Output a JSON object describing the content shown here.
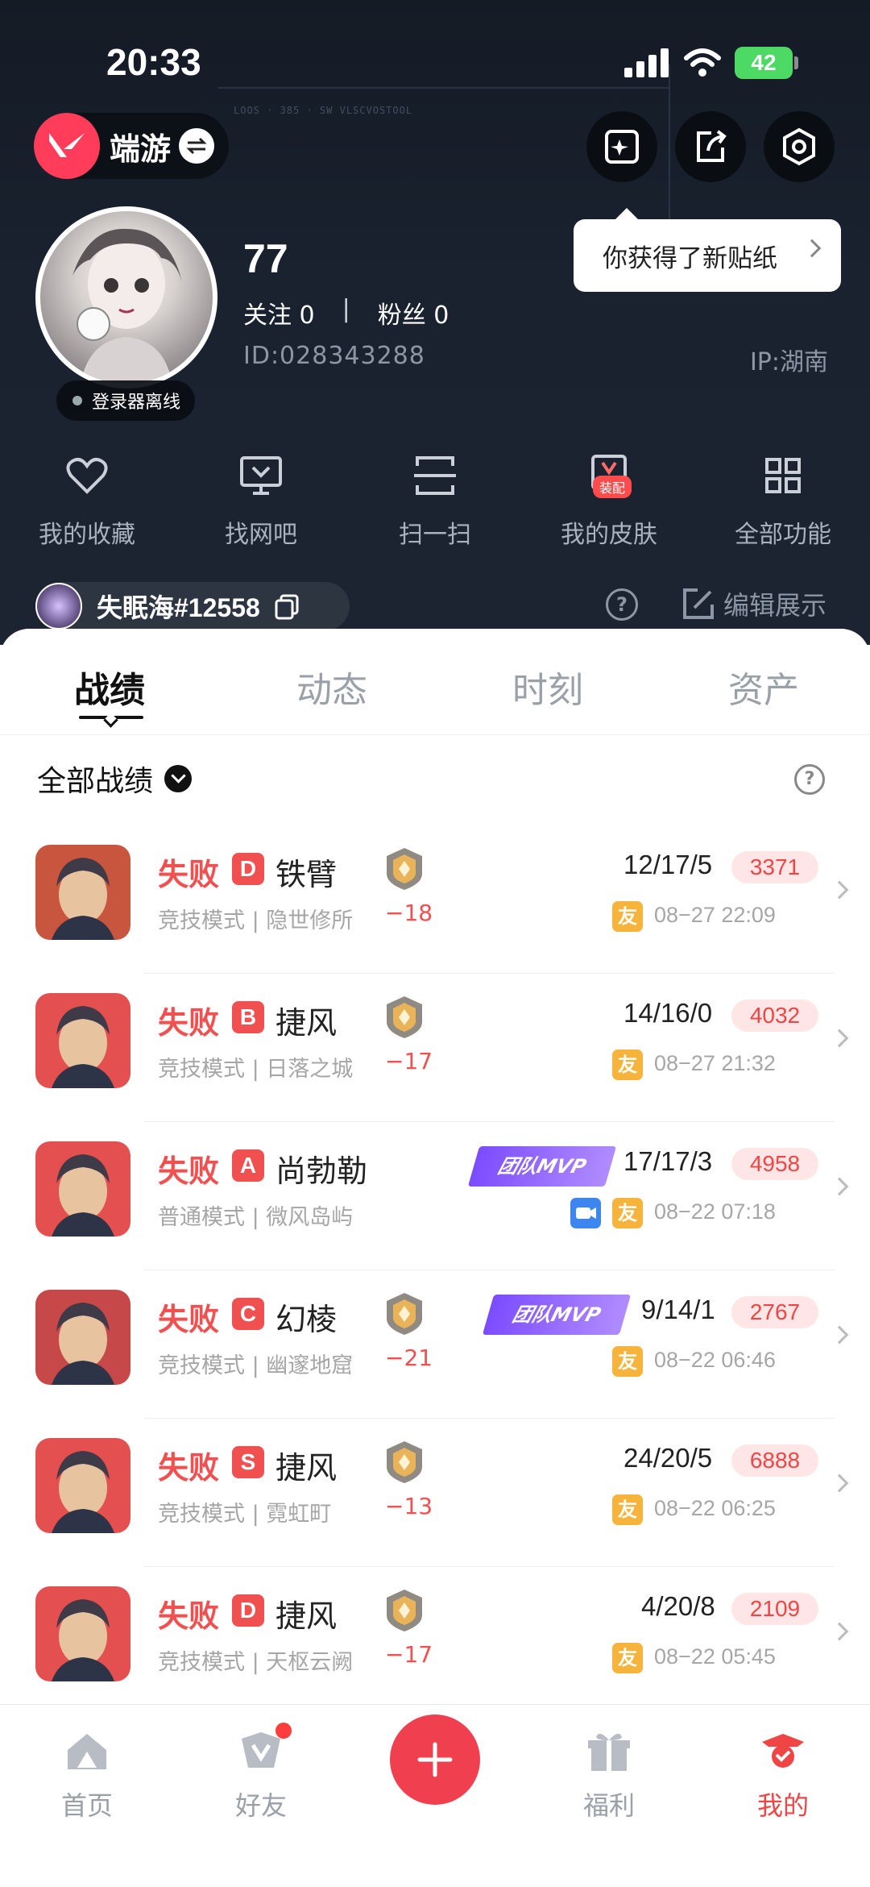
{
  "status_bar": {
    "time": "20:33",
    "battery": "42"
  },
  "header": {
    "app_switch_label": "端游",
    "tooltip": "你获得了新贴纸",
    "online_status": "登录器离线",
    "username": "77",
    "following_label": "关注 0",
    "followers_label": "粉丝 0",
    "follow_separator": "|",
    "user_id": "ID:028343288",
    "ip": "IP:湖南",
    "game_id": "失眠海#12558",
    "edit_show": "编辑展示",
    "help_glyph": "?",
    "hud_text": "LOOS · 385 · SW VLSCVOSTOOL"
  },
  "quick_actions": [
    {
      "label": "我的收藏",
      "icon": "heart-icon"
    },
    {
      "label": "找网吧",
      "icon": "monitor-icon"
    },
    {
      "label": "扫一扫",
      "icon": "scan-icon"
    },
    {
      "label": "我的皮肤",
      "icon": "skin-icon",
      "badge": "装配"
    },
    {
      "label": "全部功能",
      "icon": "grid-icon"
    }
  ],
  "tabs": [
    {
      "label": "战绩",
      "active": true
    },
    {
      "label": "动态",
      "active": false
    },
    {
      "label": "时刻",
      "active": false
    },
    {
      "label": "资产",
      "active": false
    }
  ],
  "filter": {
    "label": "全部战绩",
    "help_glyph": "?"
  },
  "matches": [
    {
      "result": "失败",
      "rank": "D",
      "agent": "铁臂",
      "mode": "竞技模式 | 隐世修所",
      "delta": "−18",
      "mvp": "",
      "kda": "12/17/5",
      "score": "3371",
      "friend": "友",
      "video": false,
      "date": "08−27 22:09",
      "agent_color": "#c8553d"
    },
    {
      "result": "失败",
      "rank": "B",
      "agent": "捷风",
      "mode": "竞技模式 | 日落之城",
      "delta": "−17",
      "mvp": "",
      "kda": "14/16/0",
      "score": "4032",
      "friend": "友",
      "video": false,
      "date": "08−27 21:32",
      "agent_color": "#e4504f"
    },
    {
      "result": "失败",
      "rank": "A",
      "agent": "尚勃勒",
      "mode": "普通模式 | 微风岛屿",
      "delta": "",
      "mvp": "团队MVP",
      "kda": "17/17/3",
      "score": "4958",
      "friend": "友",
      "video": true,
      "date": "08−22 07:18",
      "agent_color": "#e4504f"
    },
    {
      "result": "失败",
      "rank": "C",
      "agent": "幻棱",
      "mode": "竞技模式 | 幽邃地窟",
      "delta": "−21",
      "mvp": "团队MVP",
      "kda": "9/14/1",
      "score": "2767",
      "friend": "友",
      "video": false,
      "date": "08−22 06:46",
      "agent_color": "#c64848"
    },
    {
      "result": "失败",
      "rank": "S",
      "agent": "捷风",
      "mode": "竞技模式 | 霓虹町",
      "delta": "−13",
      "mvp": "",
      "kda": "24/20/5",
      "score": "6888",
      "friend": "友",
      "video": false,
      "date": "08−22 06:25",
      "agent_color": "#e4504f"
    },
    {
      "result": "失败",
      "rank": "D",
      "agent": "捷风",
      "mode": "竞技模式 | 天枢云阙",
      "delta": "−17",
      "mvp": "",
      "kda": "4/20/8",
      "score": "2109",
      "friend": "友",
      "video": false,
      "date": "08−22 05:45",
      "agent_color": "#e4504f"
    }
  ],
  "bottom_nav": [
    {
      "label": "首页",
      "active": false
    },
    {
      "label": "好友",
      "active": false,
      "dot": true
    },
    {
      "label": "",
      "fab": true
    },
    {
      "label": "福利",
      "active": false
    },
    {
      "label": "我的",
      "active": true
    }
  ],
  "colors": {
    "accent": "#f04545",
    "header_bg": "#1a2230",
    "score_bg": "#ffe6e6",
    "friend_tag": "#f6b43c",
    "mvp": "#7b4cff"
  }
}
